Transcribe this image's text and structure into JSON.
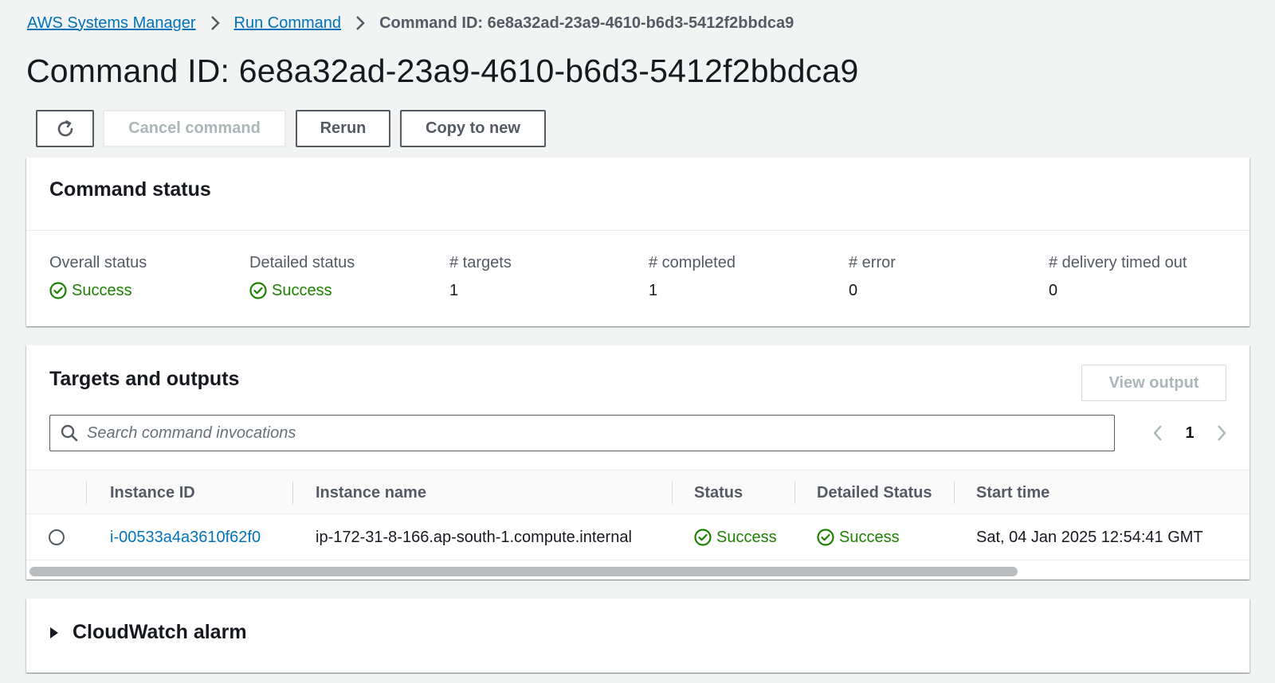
{
  "breadcrumb": {
    "items": [
      "AWS Systems Manager",
      "Run Command"
    ],
    "current": "Command ID: 6e8a32ad-23a9-4610-b6d3-5412f2bbdca9"
  },
  "page": {
    "title": "Command ID: 6e8a32ad-23a9-4610-b6d3-5412f2bbdca9"
  },
  "actions": {
    "cancel": "Cancel command",
    "rerun": "Rerun",
    "copy": "Copy to new"
  },
  "status_panel": {
    "title": "Command status",
    "stats": [
      {
        "label": "Overall status",
        "value": "Success"
      },
      {
        "label": "Detailed status",
        "value": "Success"
      },
      {
        "label": "# targets",
        "value": "1"
      },
      {
        "label": "# completed",
        "value": "1"
      },
      {
        "label": "# error",
        "value": "0"
      },
      {
        "label": "# delivery timed out",
        "value": "0"
      }
    ]
  },
  "targets_panel": {
    "title": "Targets and outputs",
    "view_output": "View output",
    "search_placeholder": "Search command invocations",
    "page": "1",
    "columns": [
      "Instance ID",
      "Instance name",
      "Status",
      "Detailed Status",
      "Start time"
    ],
    "rows": [
      {
        "instance_id": "i-00533a4a3610f62f0",
        "instance_name": "ip-172-31-8-166.ap-south-1.compute.internal",
        "status": "Success",
        "detailed_status": "Success",
        "start_time": "Sat, 04 Jan 2025 12:54:41 GMT"
      }
    ]
  },
  "alarm_panel": {
    "title": "CloudWatch alarm"
  },
  "colors": {
    "link": "#0073bb",
    "success": "#1d8102",
    "background": "#f2f3f3"
  },
  "icons": [
    "chevron-right-icon",
    "refresh-icon",
    "check-circle-icon",
    "search-icon",
    "chevron-left-icon",
    "caret-right-icon"
  ]
}
